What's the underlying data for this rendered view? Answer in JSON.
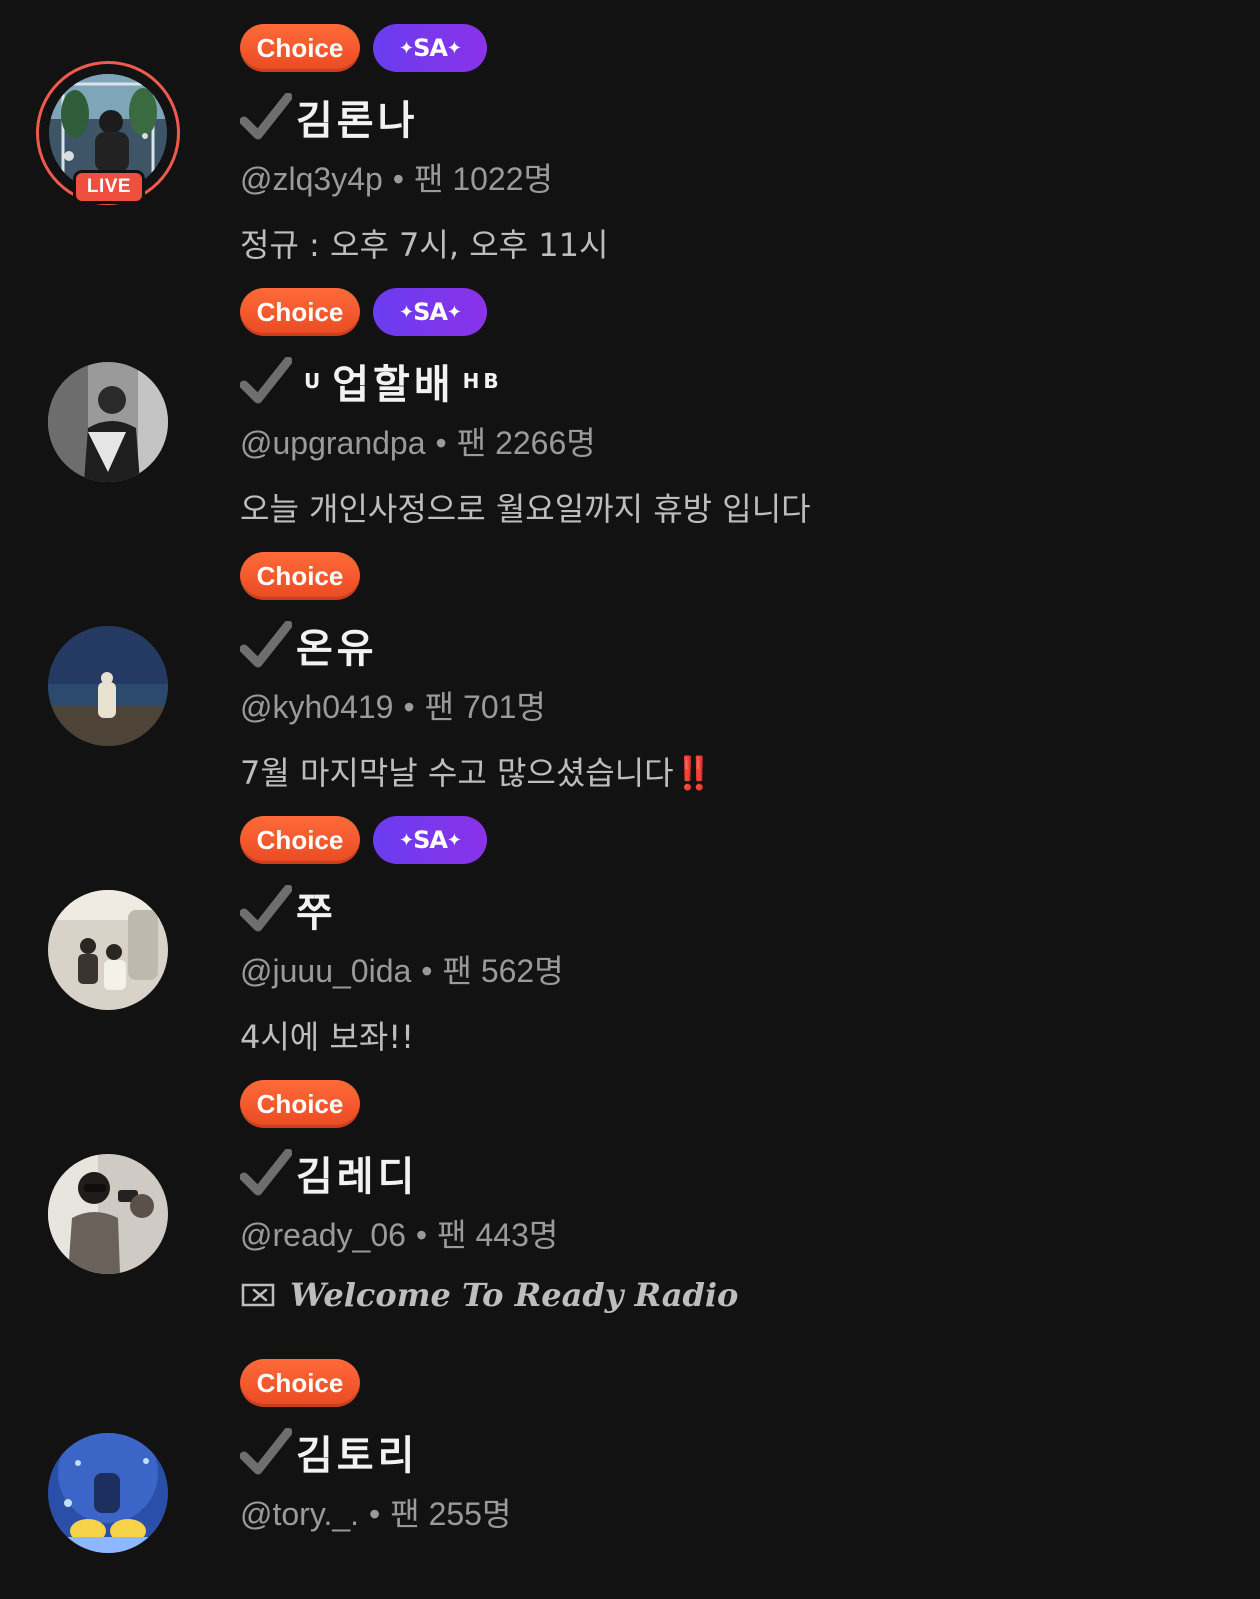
{
  "colors": {
    "background": "#121212",
    "choice_badge": "#ef5526",
    "sa_badge": "#7b36ec",
    "live_ring": "#ef5a4e",
    "verified_check": "#6e6e6e"
  },
  "badges": {
    "choice_label": "Choice",
    "sa_label": "SA"
  },
  "icons": {
    "verified": "check-icon",
    "tag": "tag-icon",
    "live": "live-badge"
  },
  "fans_prefix": "팬",
  "items": [
    {
      "badges": [
        "Choice",
        "SA"
      ],
      "live": true,
      "live_label": "LIVE",
      "name": "김론나",
      "username": "@zlq3y4p",
      "fans": "1022명",
      "message": "정규 : 오후 7시, 오후 11시"
    },
    {
      "badges": [
        "Choice",
        "SA"
      ],
      "live": false,
      "name_prefix": "U",
      "name": "업할배",
      "name_suffix": "HB",
      "username": "@upgrandpa",
      "fans": "2266명",
      "message": "오늘 개인사정으로 월요일까지 휴방 입니다"
    },
    {
      "badges": [
        "Choice"
      ],
      "live": false,
      "name": "온유",
      "username": "@kyh0419",
      "fans": "701명",
      "message": "7월 마지막날 수고 많으셨습니다",
      "message_emoji": "‼️"
    },
    {
      "badges": [
        "Choice",
        "SA"
      ],
      "live": false,
      "name": "쭈",
      "username": "@juuu_0ida",
      "fans": "562명",
      "message": "4시에 보좌!!"
    },
    {
      "badges": [
        "Choice"
      ],
      "live": false,
      "name": "김레디",
      "username": "@ready_06",
      "fans": "443명",
      "message": "Welcome To Ready Radio"
    },
    {
      "badges": [
        "Choice"
      ],
      "live": false,
      "name": "김토리",
      "username": "@tory._.",
      "fans": "255명",
      "message": ""
    }
  ]
}
